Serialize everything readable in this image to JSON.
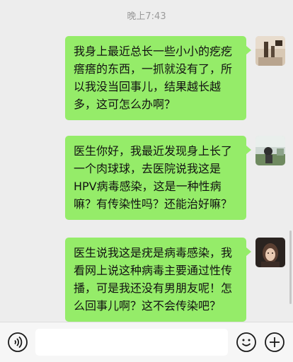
{
  "header": {
    "timestamp": "晚上7:43"
  },
  "messages": [
    {
      "sender": "self",
      "avatar": "avatar-photo-1",
      "text": "我身上最近总长一些小小的疙疙瘩瘩的东西，一抓就没有了，所以我没当回事儿，结果越长越多，这可怎么办啊？"
    },
    {
      "sender": "self",
      "avatar": "avatar-photo-2",
      "text": "医生你好，我最近发现身上长了一个肉球球，去医院说我这是HPV病毒感染，这是一种性病嘛？有传染性吗？还能治好嘛？"
    },
    {
      "sender": "self",
      "avatar": "avatar-photo-3",
      "text": "医生说我这是疣是病毒感染，我看网上说这种病毒主要通过性传播，可是我还没有男朋友呢！怎么回事儿啊？这不会传染吧？"
    }
  ],
  "input_bar": {
    "voice_icon": "voice-icon",
    "text_value": "",
    "emoji_icon": "emoji-icon",
    "plus_icon": "plus-icon"
  },
  "colors": {
    "background": "#ededed",
    "bubble_self": "#95ec69",
    "input_bar": "#f6f6f6"
  }
}
